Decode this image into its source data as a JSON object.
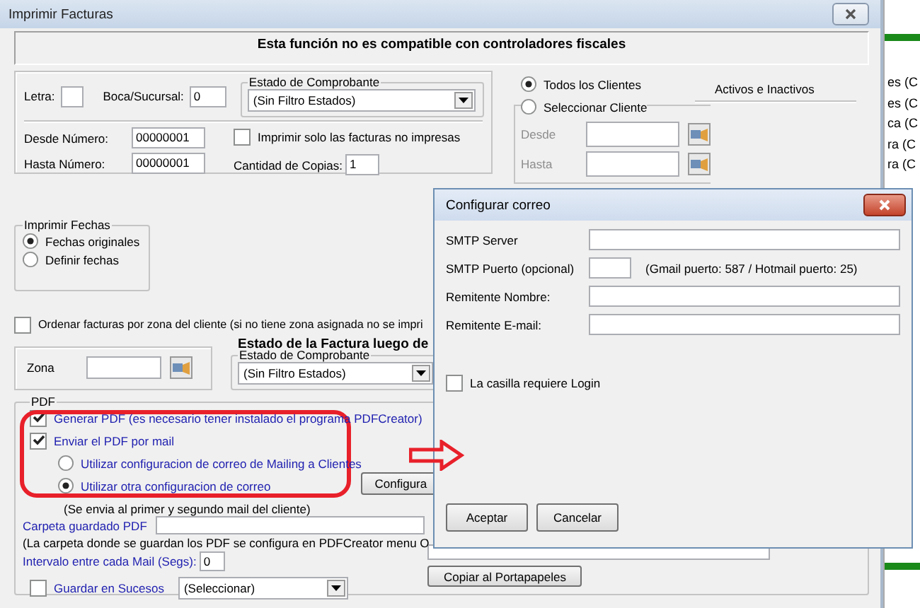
{
  "main_window": {
    "title": "Imprimir Facturas",
    "banner": "Esta función no es compatible con controladores fiscales",
    "numbers": {
      "letra_label": "Letra:",
      "sucursal_label": "Boca/Sucursal:",
      "sucursal_value": "0",
      "estado_group": "Estado de Comprobante",
      "estado_select": "(Sin Filtro Estados)",
      "desde_label": "Desde Número:",
      "desde_value": "00000001",
      "hasta_label": "Hasta Número:",
      "hasta_value": "00000001",
      "solo_no_impresas": {
        "label": "Imprimir solo las facturas no impresas",
        "checked": false
      },
      "copias_label": "Cantidad de Copias:",
      "copias_value": "1"
    },
    "clients": {
      "options": [
        {
          "label": "Todos los Clientes",
          "selected": true
        },
        {
          "label": "Seleccionar Cliente",
          "selected": false
        }
      ],
      "filter_label": "Activos e Inactivos",
      "desde_label": "Desde",
      "hasta_label": "Hasta",
      "disabled": true
    },
    "fechas": {
      "title": "Imprimir Fechas",
      "options": [
        {
          "label": "Fechas originales",
          "selected": true
        },
        {
          "label": "Definir fechas",
          "selected": false
        }
      ]
    },
    "ordenar": {
      "label": "Ordenar facturas por zona del cliente (si no tiene zona asignada no se impri",
      "checked": false
    },
    "zona": {
      "label": "Zona"
    },
    "estado_posterior": {
      "heading": "Estado de la Factura luego de",
      "group": "Estado de Comprobante",
      "select": "(Sin Filtro Estados)"
    },
    "pdf": {
      "title": "PDF",
      "generar": {
        "label": "Generar PDF (es necesario tener instalado el programa PDFCreator)",
        "checked": true
      },
      "enviar": {
        "label": "Enviar el PDF por mail",
        "checked": true
      },
      "mail_options": [
        {
          "label": "Utilizar configuracion de correo de Mailing a Clientes",
          "selected": false
        },
        {
          "label": "Utilizar otra configuracion de correo",
          "selected": true
        }
      ],
      "configurar_button": "Configura",
      "note": "(Se envia al primer y segundo mail del cliente)",
      "carpeta_label": "Carpeta guardado PDF",
      "carpeta_note": "(La carpeta donde se guardan los PDF se configura en PDFCreator menu O",
      "intervalo_label": "Intervalo entre cada Mail (Segs):",
      "intervalo_value": "0",
      "sucesos": {
        "label": "Guardar en Sucesos",
        "checked": false,
        "select": "(Seleccionar)"
      },
      "copy_button": "Copiar al Portapapeles"
    }
  },
  "background_list": [
    "es (C",
    "es (C",
    "ca (C",
    "ra (C",
    "ra (C"
  ],
  "dialog": {
    "title": "Configurar correo",
    "fields": [
      {
        "label": "SMTP Server",
        "kind": "wide"
      },
      {
        "label": "SMTP Puerto (opcional)",
        "kind": "short",
        "hint": "(Gmail puerto: 587 / Hotmail puerto: 25)"
      },
      {
        "label": "Remitente Nombre:",
        "kind": "wide"
      },
      {
        "label": "Remitente E-mail:",
        "kind": "wide"
      }
    ],
    "login": {
      "label": "La casilla requiere Login",
      "checked": false
    },
    "buttons": [
      "Aceptar",
      "Cancelar"
    ]
  }
}
